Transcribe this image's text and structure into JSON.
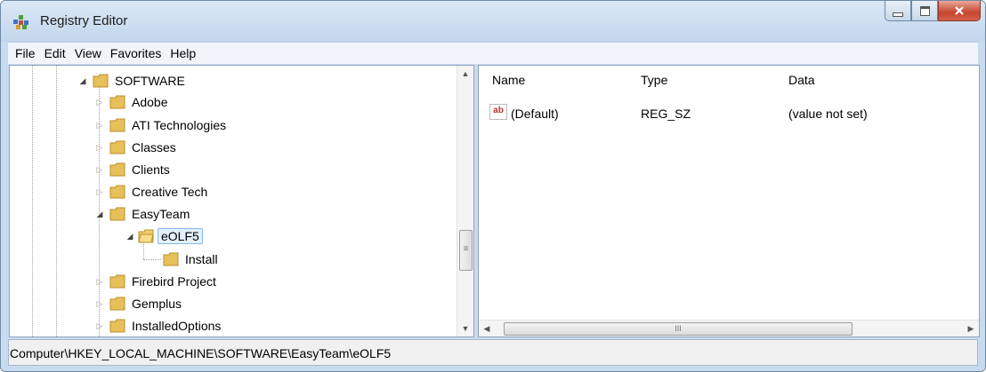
{
  "window": {
    "title": "Registry Editor"
  },
  "menu": [
    "File",
    "Edit",
    "View",
    "Favorites",
    "Help"
  ],
  "tree": [
    {
      "label": "SOFTWARE",
      "state": "expanded"
    },
    {
      "label": "Adobe",
      "state": "collapsed"
    },
    {
      "label": "ATI Technologies",
      "state": "collapsed"
    },
    {
      "label": "Classes",
      "state": "collapsed"
    },
    {
      "label": "Clients",
      "state": "collapsed"
    },
    {
      "label": "Creative Tech",
      "state": "collapsed"
    },
    {
      "label": "EasyTeam",
      "state": "expanded"
    },
    {
      "label": "eOLF5",
      "state": "expanded",
      "selected": true
    },
    {
      "label": "Install",
      "state": "leaf"
    },
    {
      "label": "Firebird Project",
      "state": "collapsed"
    },
    {
      "label": "Gemplus",
      "state": "collapsed"
    },
    {
      "label": "InstalledOptions",
      "state": "collapsed"
    }
  ],
  "list": {
    "columns": [
      "Name",
      "Type",
      "Data"
    ],
    "rows": [
      {
        "icon": "string-value-icon",
        "icon_text": "ab",
        "name": "(Default)",
        "type": "REG_SZ",
        "data": "(value not set)"
      }
    ]
  },
  "status": {
    "path": "Computer\\HKEY_LOCAL_MACHINE\\SOFTWARE\\EasyTeam\\eOLF5"
  },
  "scrollbars": {
    "tree_grip": "≡",
    "list_grip": "III"
  },
  "colors": {
    "folder": "#e8c05a",
    "selection_border": "#86b7e8",
    "close_button": "#c7442e"
  }
}
